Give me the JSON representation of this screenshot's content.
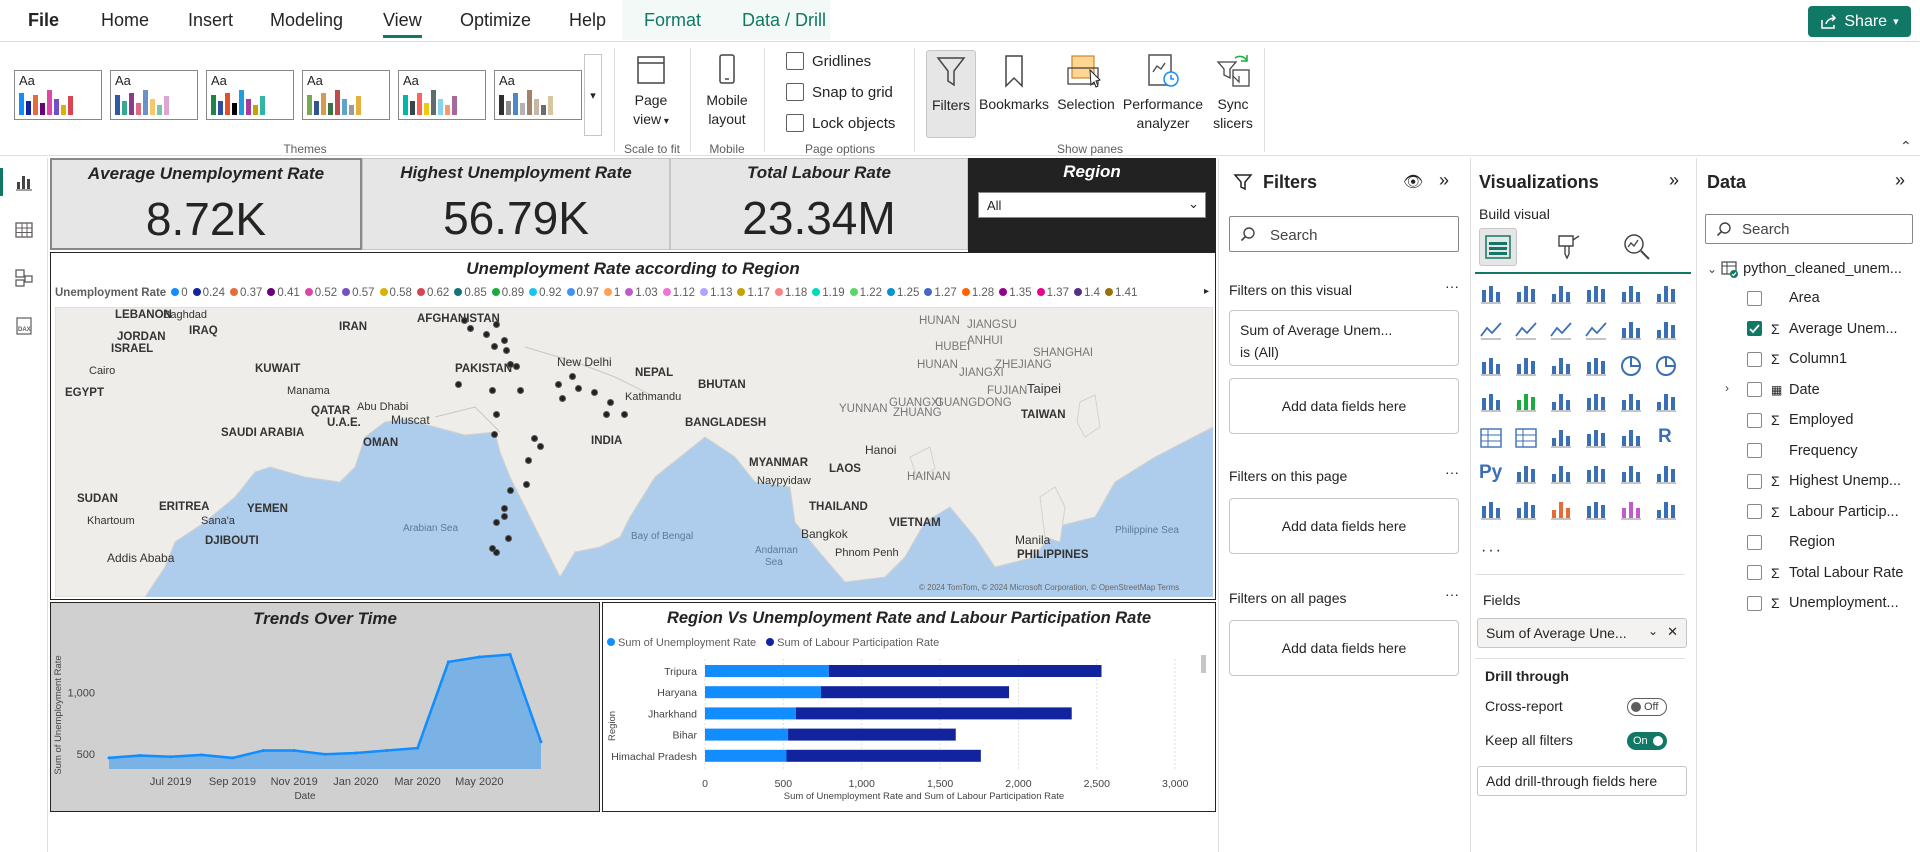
{
  "ribbon": {
    "tabs": [
      "File",
      "Home",
      "Insert",
      "Modeling",
      "View",
      "Optimize",
      "Help",
      "Format",
      "Data / Drill"
    ],
    "active_tab": "View",
    "share_label": "Share",
    "themes_label": "Themes",
    "theme_sample": "Aa",
    "page_view_label": "Page",
    "page_view_label2": "view",
    "scale_to_fit_label": "Scale to fit",
    "mobile_label": "Mobile",
    "mobile_label2": "layout",
    "mobile_group_label": "Mobile",
    "gridlines_label": "Gridlines",
    "snap_label": "Snap to grid",
    "lock_label": "Lock objects",
    "page_options_label": "Page options",
    "filters_btn": "Filters",
    "bookmarks_btn": "Bookmarks",
    "selection_btn": "Selection",
    "performance_btn": "Performance",
    "performance_btn2": "analyzer",
    "sync_btn": "Sync",
    "sync_btn2": "slicers",
    "show_panes_label": "Show panes"
  },
  "cards": [
    {
      "title": "Average Unemployment Rate",
      "value": "8.72K"
    },
    {
      "title": "Highest Unemployment Rate",
      "value": "56.79K"
    },
    {
      "title": "Total Labour Rate",
      "value": "23.34M"
    }
  ],
  "region_slicer": {
    "title": "Region",
    "value": "All"
  },
  "map": {
    "title": "Unemployment Rate according to Region",
    "legend_title": "Unemployment Rate",
    "legend": [
      {
        "v": "0",
        "c": "#118dff"
      },
      {
        "v": "0.24",
        "c": "#12239e"
      },
      {
        "v": "0.37",
        "c": "#e66c37"
      },
      {
        "v": "0.41",
        "c": "#6b007b"
      },
      {
        "v": "0.52",
        "c": "#e044a7"
      },
      {
        "v": "0.57",
        "c": "#744ec2"
      },
      {
        "v": "0.58",
        "c": "#d9b300"
      },
      {
        "v": "0.62",
        "c": "#d64550"
      },
      {
        "v": "0.85",
        "c": "#197278"
      },
      {
        "v": "0.89",
        "c": "#1aab40"
      },
      {
        "v": "0.92",
        "c": "#15c6f4"
      },
      {
        "v": "0.97",
        "c": "#4092ff"
      },
      {
        "v": "1",
        "c": "#ffa058"
      },
      {
        "v": "1.03",
        "c": "#be5dc9"
      },
      {
        "v": "1.12",
        "c": "#f472d0"
      },
      {
        "v": "1.13",
        "c": "#b5a1ff"
      },
      {
        "v": "1.17",
        "c": "#c4a200"
      },
      {
        "v": "1.18",
        "c": "#ff8080"
      },
      {
        "v": "1.19",
        "c": "#00dbbc"
      },
      {
        "v": "1.22",
        "c": "#5bd667"
      },
      {
        "v": "1.25",
        "c": "#0091d5"
      },
      {
        "v": "1.27",
        "c": "#4668c5"
      },
      {
        "v": "1.28",
        "c": "#ff6300"
      },
      {
        "v": "1.35",
        "c": "#99008a"
      },
      {
        "v": "1.37",
        "c": "#ec008c"
      },
      {
        "v": "1.4",
        "c": "#533285"
      },
      {
        "v": "1.41",
        "c": "#99700a"
      }
    ],
    "labels": {
      "lebanon": "LEBANON",
      "baghdad": "Baghdad",
      "jordan": "JORDAN",
      "israel": "ISRAEL",
      "iraq": "IRAQ",
      "iran": "IRAN",
      "afghanistan": "AFGHANISTAN",
      "cairo": "Cairo",
      "kuwait": "KUWAIT",
      "pakistan": "PAKISTAN",
      "egypt": "EGYPT",
      "manama": "Manama",
      "qatar": "QATAR",
      "abudhabi": "Abu Dhabi",
      "uae": "U.A.E.",
      "muscat": "Muscat",
      "oman": "OMAN",
      "saudi": "SAUDI ARABIA",
      "newdelhi": "New Delhi",
      "nepal": "NEPAL",
      "kathmandu": "Kathmandu",
      "bhutan": "BHUTAN",
      "bangladesh": "BANGLADESH",
      "india": "INDIA",
      "myanmar": "MYANMAR",
      "naypyidaw": "Naypyidaw",
      "laos": "LAOS",
      "hanoi": "Hanoi",
      "thailand": "THAILAND",
      "bangkok": "Bangkok",
      "vietnam": "VIETNAM",
      "phnompenh": "Phnom Penh",
      "sudan": "SUDAN",
      "eritrea": "ERITREA",
      "yemen": "YEMEN",
      "khartoum": "Khartoum",
      "sanaa": "Sana'a",
      "djibouti": "DJIBOUTI",
      "addis": "Addis Ababa",
      "arabiansea": "Arabian Sea",
      "bayofbengal": "Bay of Bengal",
      "andaman": "Andaman",
      "andaman2": "Sea",
      "jiangsu": "JIANGSU",
      "shanghai": "SHANGHAI",
      "hubei": "HUBEI",
      "anhui": "ANHUI",
      "zhejiang": "ZHEJIANG",
      "hunan": "HUNAN",
      "jiangxi": "JIANGXI",
      "fujian": "FUJIAN",
      "taipei": "Taipei",
      "taiwan": "TAIWAN",
      "guangdong": "GUANGDONG",
      "guangxi": "GUANGXI",
      "guangxi2": "ZHUANG",
      "yunnan": "YUNNAN",
      "hainan": "HAINAN",
      "manila": "Manila",
      "philippines": "PHILIPPINES",
      "phsea": "Philippine Sea",
      "copyright": "© 2024 TomTom, © 2024 Microsoft Corporation, © OpenStreetMap  Terms"
    }
  },
  "trend": {
    "title": "Trends Over Time",
    "ylabel": "Sum of Unemployment Rate",
    "xlabel": "Date",
    "yticks": [
      "500",
      "1,000"
    ],
    "xticks": [
      "Jul 2019",
      "Sep 2019",
      "Nov 2019",
      "Jan 2020",
      "Mar 2020",
      "May 2020"
    ]
  },
  "bar": {
    "title": "Region Vs Unemployment Rate and Labour Participation Rate",
    "legend1": "Sum of Unemployment Rate",
    "legend2": "Sum of Labour Participation Rate",
    "ylabel": "Region",
    "xlabel": "Sum of Unemployment Rate and Sum of Labour Participation Rate",
    "xticks": [
      "0",
      "500",
      "1,000",
      "1,500",
      "2,000",
      "2,500",
      "3,000"
    ]
  },
  "chart_data": [
    {
      "type": "area",
      "title": "Trends Over Time",
      "xlabel": "Date",
      "ylabel": "Sum of Unemployment Rate",
      "x": [
        "May 2019",
        "Jun 2019",
        "Jul 2019",
        "Aug 2019",
        "Sep 2019",
        "Oct 2019",
        "Nov 2019",
        "Dec 2019",
        "Jan 2020",
        "Feb 2020",
        "Mar 2020",
        "Apr 2020",
        "May 2020",
        "Jun 2020",
        "Jul 2020"
      ],
      "values": [
        470,
        490,
        480,
        495,
        470,
        530,
        530,
        500,
        510,
        530,
        550,
        1250,
        1290,
        1310,
        600
      ],
      "ylim": [
        380,
        1420
      ]
    },
    {
      "type": "bar",
      "orientation": "horizontal",
      "stacked": true,
      "title": "Region Vs Unemployment Rate and Labour Participation Rate",
      "categories": [
        "Tripura",
        "Haryana",
        "Jharkhand",
        "Bihar",
        "Himachal Pradesh"
      ],
      "series": [
        {
          "name": "Sum of Unemployment Rate",
          "values": [
            790,
            740,
            580,
            530,
            520
          ],
          "color": "#118dff"
        },
        {
          "name": "Sum of Labour Participation Rate",
          "values": [
            1740,
            1200,
            1760,
            1070,
            1240
          ],
          "color": "#12239e"
        }
      ],
      "xlim": [
        0,
        3050
      ]
    }
  ],
  "filters": {
    "title": "Filters",
    "search": "Search",
    "on_visual": "Filters on this visual",
    "visual_filter_line1": "Sum of Average Unem...",
    "visual_filter_line2": "is (All)",
    "add": "Add data fields here",
    "on_page": "Filters on this page",
    "on_all": "Filters on all pages"
  },
  "viz": {
    "title": "Visualizations",
    "build": "Build visual",
    "fields": "Fields",
    "field_value": "Sum of Average Une...",
    "drill": "Drill through",
    "cross": "Cross-report",
    "cross_state": "Off",
    "keep": "Keep all filters",
    "keep_state": "On",
    "add_drill": "Add drill-through fields here",
    "more": "···",
    "py": "Py",
    "r": "R"
  },
  "data_pane": {
    "title": "Data",
    "search": "Search",
    "table": "python_cleaned_unem...",
    "fields": [
      {
        "name": "Area",
        "sigma": false,
        "checked": false,
        "expand": false
      },
      {
        "name": "Average Unem...",
        "sigma": true,
        "checked": true,
        "expand": false
      },
      {
        "name": "Column1",
        "sigma": true,
        "checked": false,
        "expand": false
      },
      {
        "name": "Date",
        "sigma": false,
        "checked": false,
        "expand": true
      },
      {
        "name": "Employed",
        "sigma": true,
        "checked": false,
        "expand": false
      },
      {
        "name": "Frequency",
        "sigma": false,
        "checked": false,
        "expand": false
      },
      {
        "name": "Highest Unemp...",
        "sigma": true,
        "checked": false,
        "expand": false
      },
      {
        "name": "Labour Particip...",
        "sigma": true,
        "checked": false,
        "expand": false
      },
      {
        "name": "Region",
        "sigma": false,
        "checked": false,
        "expand": false
      },
      {
        "name": "Total Labour Rate",
        "sigma": true,
        "checked": false,
        "expand": false
      },
      {
        "name": "Unemployment...",
        "sigma": true,
        "checked": false,
        "expand": false
      }
    ]
  },
  "colors": {
    "accent": "#117865",
    "bar_light": "#118dff",
    "bar_dark": "#12239e",
    "area": "#118dff"
  }
}
